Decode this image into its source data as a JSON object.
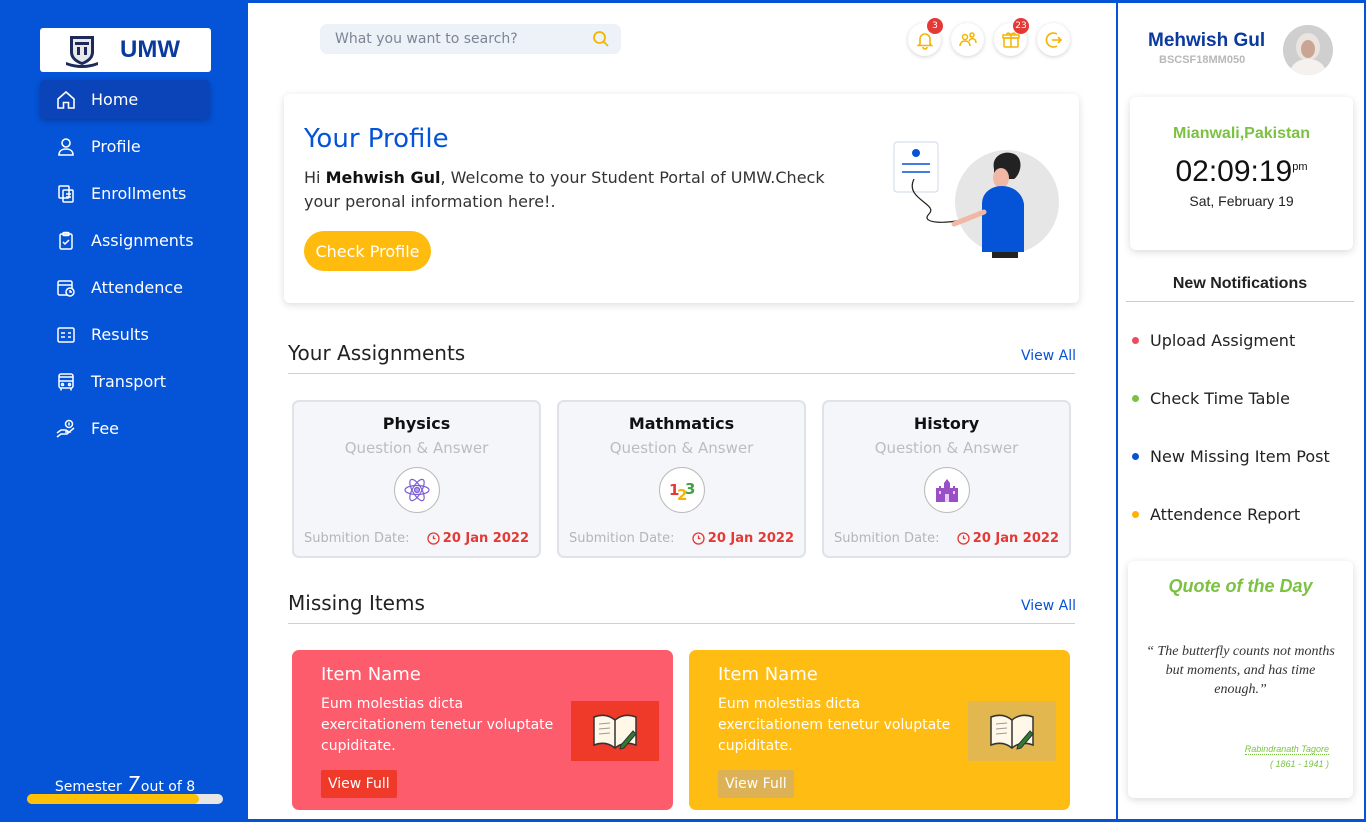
{
  "brand": {
    "name": "UMW"
  },
  "sidebar": {
    "items": [
      {
        "label": "Home",
        "icon": "home-icon"
      },
      {
        "label": "Profile",
        "icon": "user-icon"
      },
      {
        "label": "Enrollments",
        "icon": "enrollments-icon"
      },
      {
        "label": "Assignments",
        "icon": "clipboard-icon"
      },
      {
        "label": "Attendence",
        "icon": "attendance-icon"
      },
      {
        "label": "Results",
        "icon": "results-icon"
      },
      {
        "label": "Transport",
        "icon": "bus-icon"
      },
      {
        "label": "Fee",
        "icon": "fee-icon"
      }
    ],
    "semester": {
      "prefix": "Semester",
      "current": "7",
      "suffix": "out of 8",
      "progress": 0.875
    }
  },
  "header": {
    "search_placeholder": "What you want to search?",
    "icons": [
      {
        "icon": "bell-icon",
        "badge": "3"
      },
      {
        "icon": "users-icon",
        "badge": ""
      },
      {
        "icon": "gift-icon",
        "badge": "23"
      },
      {
        "icon": "logout-icon",
        "badge": ""
      }
    ]
  },
  "profile_card": {
    "title": "Your Profile",
    "greeting": "Hi",
    "name": "Mehwish Gul",
    "message": ", Welcome to your Student Portal of UMW.Check your peronal information here!.",
    "button": "Check Profile"
  },
  "assignments": {
    "title": "Your Assignments",
    "view_all": "View All",
    "items": [
      {
        "subject": "Physics",
        "type": "Question & Answer",
        "date_label": "Submition Date:",
        "date": "20 Jan 2022",
        "icon": "atom-icon"
      },
      {
        "subject": "Mathmatics",
        "type": "Question & Answer",
        "date_label": "Submition Date:",
        "date": "20 Jan 2022",
        "icon": "numbers-icon"
      },
      {
        "subject": "History",
        "type": "Question & Answer",
        "date_label": "Submition Date:",
        "date": "20 Jan 2022",
        "icon": "castle-icon"
      }
    ]
  },
  "missing_items": {
    "title": "Missing Items",
    "view_all": "View All",
    "items": [
      {
        "title": "Item Name",
        "description": "Eum molestias dicta exercitationem tenetur voluptate cupiditate.",
        "button": "View Full",
        "color": "#fd5c6c",
        "button_color": "#ef3a2a",
        "image_bg": "#ef3a2a"
      },
      {
        "title": "Item Name",
        "description": "Eum molestias dicta exercitationem tenetur voluptate cupiditate.",
        "button": "View Full",
        "color": "#ffbc12",
        "button_color": "#ddb155",
        "image_bg": "#e2b750"
      }
    ]
  },
  "user": {
    "name": "Mehwish Gul",
    "id": "BSCSF18MM050"
  },
  "clock": {
    "city": "Mianwali,Pakistan",
    "time": "02:09:19",
    "ampm": "pm",
    "date": "Sat, February 19"
  },
  "notifications": {
    "title": "New Notifications",
    "items": [
      {
        "label": "Upload Assigment",
        "color": "#f04a5e"
      },
      {
        "label": "Check Time Table",
        "color": "#7cc242"
      },
      {
        "label": "New Missing Item Post",
        "color": "#0553d6"
      },
      {
        "label": "Attendence Report",
        "color": "#ffb300"
      }
    ]
  },
  "quote": {
    "title": "Quote of the Day",
    "text": "“ The butterfly counts not months but moments, and has time enough.”",
    "author": "Rabindranath Tagore",
    "years": "( 1861 - 1941 )"
  },
  "colors": {
    "primary": "#0553d6",
    "accent": "#ffbc0e",
    "green": "#7cc242",
    "danger": "#e53935"
  }
}
